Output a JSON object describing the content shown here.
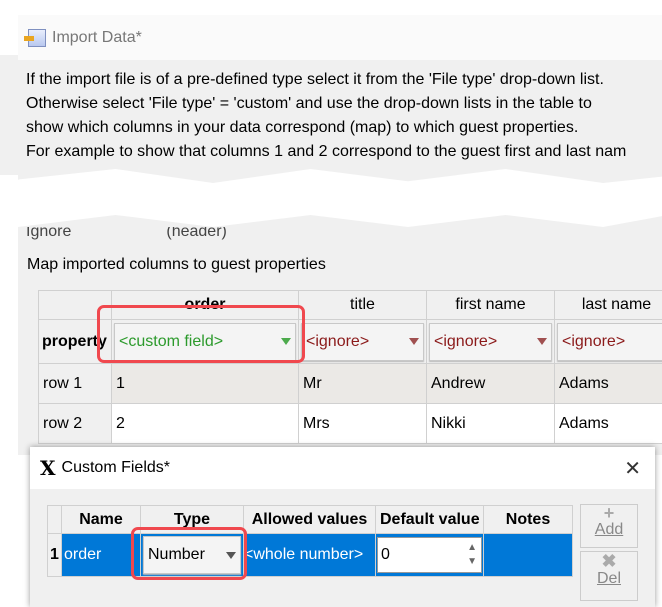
{
  "import_dialog": {
    "title": "Import Data*",
    "instructions": [
      "If the import file is of a pre-defined type select it from the 'File type' drop-down list.",
      "Otherwise select 'File type' = 'custom' and use the drop-down lists in the table to",
      "show which columns in your data correspond (map) to which guest properties.",
      "For example to show that columns 1 and 2 correspond to the guest first and last nam"
    ],
    "ignore_label": "Ignore",
    "header_label": "(header)",
    "map_label": "Map imported columns to guest properties",
    "columns": [
      "order",
      "title",
      "first name",
      "last name"
    ],
    "property_label": "property",
    "properties": [
      "<custom field>",
      "<ignore>",
      "<ignore>",
      "<ignore>"
    ],
    "rows": [
      {
        "label": "row 1",
        "cells": [
          "1",
          "Mr",
          "Andrew",
          "Adams"
        ]
      },
      {
        "label": "row 2",
        "cells": [
          "2",
          "Mrs",
          "Nikki",
          "Adams"
        ]
      }
    ]
  },
  "custom_fields_dialog": {
    "title": "Custom Fields*",
    "close_icon": "close-icon",
    "columns": [
      "Name",
      "Type",
      "Allowed values",
      "Default value",
      "Notes"
    ],
    "rows": [
      {
        "num": "1",
        "name": "order",
        "type": "Number",
        "allowed": "<whole number>",
        "default": "0",
        "notes": ""
      }
    ],
    "add_label": "Add",
    "del_label": "Del"
  },
  "colors": {
    "highlight": "#f0484e",
    "selection": "#0078d7",
    "custom_field": "#2c9a2c",
    "ignore": "#8b1a1a"
  }
}
